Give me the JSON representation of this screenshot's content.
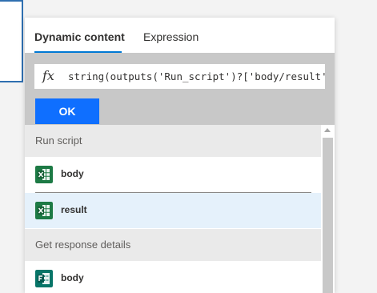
{
  "tabs": [
    {
      "label": "Dynamic content",
      "active": true
    },
    {
      "label": "Expression",
      "active": false
    }
  ],
  "expression": {
    "icon": "fx-icon",
    "value": "string(outputs('Run_script')?['body/result'])"
  },
  "ok_label": "OK",
  "sections": [
    {
      "header": "Run script",
      "items": [
        {
          "label": "body",
          "icon": "excel-icon",
          "selected": false
        },
        {
          "label": "result",
          "icon": "excel-icon",
          "selected": true
        }
      ]
    },
    {
      "header": "Get response details",
      "items": [
        {
          "label": "body",
          "icon": "forms-icon",
          "selected": false
        }
      ]
    }
  ],
  "colors": {
    "accent": "#0078d4",
    "ok_button": "#0f6fff",
    "excel_green": "#1d7a45",
    "forms_teal": "#077568",
    "selected_row": "#e5f1fb"
  }
}
